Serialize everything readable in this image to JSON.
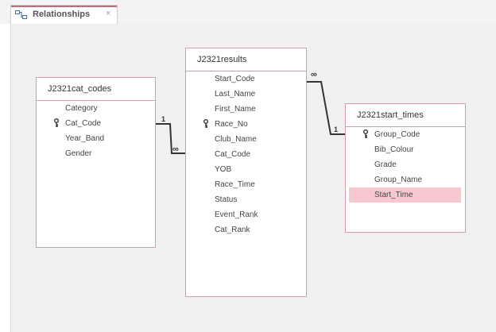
{
  "tab": {
    "icon": "relationships-icon",
    "label": "Relationships",
    "close": "×"
  },
  "tables": {
    "cat_codes": {
      "title": "J2321cat_codes",
      "fields": [
        {
          "name": "Category",
          "key": false
        },
        {
          "name": "Cat_Code",
          "key": true
        },
        {
          "name": "Year_Band",
          "key": false
        },
        {
          "name": "Gender",
          "key": false
        }
      ]
    },
    "results": {
      "title": "J2321results",
      "fields": [
        {
          "name": "Start_Code",
          "key": false
        },
        {
          "name": "Last_Name",
          "key": false
        },
        {
          "name": "First_Name",
          "key": false
        },
        {
          "name": "Race_No",
          "key": true
        },
        {
          "name": "Club_Name",
          "key": false
        },
        {
          "name": "Cat_Code",
          "key": false
        },
        {
          "name": "YOB",
          "key": false
        },
        {
          "name": "Race_Time",
          "key": false
        },
        {
          "name": "Status",
          "key": false
        },
        {
          "name": "Event_Rank",
          "key": false
        },
        {
          "name": "Cat_Rank",
          "key": false
        }
      ]
    },
    "start_times": {
      "title": "J2321start_times",
      "fields": [
        {
          "name": "Group_Code",
          "key": true
        },
        {
          "name": "Bib_Colour",
          "key": false
        },
        {
          "name": "Grade",
          "key": false
        },
        {
          "name": "Group_Name",
          "key": false
        },
        {
          "name": "Start_Time",
          "key": false,
          "selected": true
        }
      ]
    }
  },
  "relationships": {
    "cat_to_results": {
      "one": "1",
      "many": "∞"
    },
    "results_to_start": {
      "many": "∞",
      "one": "1"
    }
  },
  "colors": {
    "border": "#d59da6",
    "selected": "#f7c9cf",
    "accent": "#c06b78",
    "canvas": "#f0f0f0"
  }
}
